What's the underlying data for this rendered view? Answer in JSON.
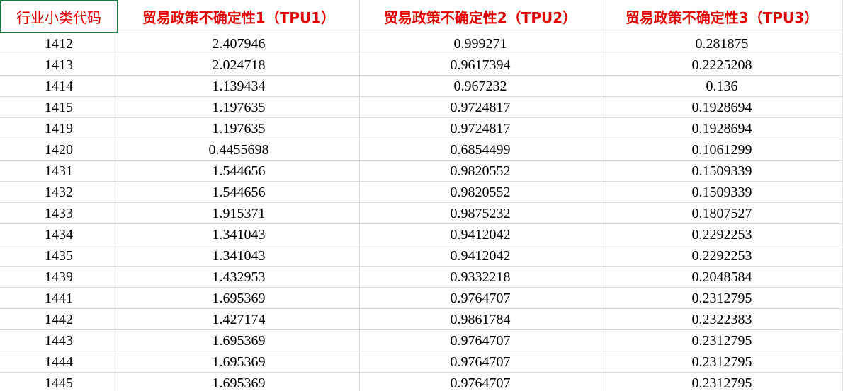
{
  "header": {
    "col1": "行业小类代码",
    "col2": "贸易政策不确定性1（TPU1）",
    "col3": "贸易政策不确定性2（TPU2）",
    "col4": "贸易政策不确定性3（TPU3）"
  },
  "header_color": "#e00000",
  "rows": [
    {
      "code": "1412",
      "tpu1": "2.407946",
      "tpu2": "0.999271",
      "tpu3": "0.281875"
    },
    {
      "code": "1413",
      "tpu1": "2.024718",
      "tpu2": "0.9617394",
      "tpu3": "0.2225208"
    },
    {
      "code": "1414",
      "tpu1": "1.139434",
      "tpu2": "0.967232",
      "tpu3": "0.136"
    },
    {
      "code": "1415",
      "tpu1": "1.197635",
      "tpu2": "0.9724817",
      "tpu3": "0.1928694"
    },
    {
      "code": "1419",
      "tpu1": "1.197635",
      "tpu2": "0.9724817",
      "tpu3": "0.1928694"
    },
    {
      "code": "1420",
      "tpu1": "0.4455698",
      "tpu2": "0.6854499",
      "tpu3": "0.1061299"
    },
    {
      "code": "1431",
      "tpu1": "1.544656",
      "tpu2": "0.9820552",
      "tpu3": "0.1509339"
    },
    {
      "code": "1432",
      "tpu1": "1.544656",
      "tpu2": "0.9820552",
      "tpu3": "0.1509339"
    },
    {
      "code": "1433",
      "tpu1": "1.915371",
      "tpu2": "0.9875232",
      "tpu3": "0.1807527"
    },
    {
      "code": "1434",
      "tpu1": "1.341043",
      "tpu2": "0.9412042",
      "tpu3": "0.2292253"
    },
    {
      "code": "1435",
      "tpu1": "1.341043",
      "tpu2": "0.9412042",
      "tpu3": "0.2292253"
    },
    {
      "code": "1439",
      "tpu1": "1.432953",
      "tpu2": "0.9332218",
      "tpu3": "0.2048584"
    },
    {
      "code": "1441",
      "tpu1": "1.695369",
      "tpu2": "0.9764707",
      "tpu3": "0.2312795"
    },
    {
      "code": "1442",
      "tpu1": "1.427174",
      "tpu2": "0.9861784",
      "tpu3": "0.2322383"
    },
    {
      "code": "1443",
      "tpu1": "1.695369",
      "tpu2": "0.9764707",
      "tpu3": "0.2312795"
    },
    {
      "code": "1444",
      "tpu1": "1.695369",
      "tpu2": "0.9764707",
      "tpu3": "0.2312795"
    },
    {
      "code": "1445",
      "tpu1": "1.695369",
      "tpu2": "0.9764707",
      "tpu3": "0.2312795"
    }
  ]
}
